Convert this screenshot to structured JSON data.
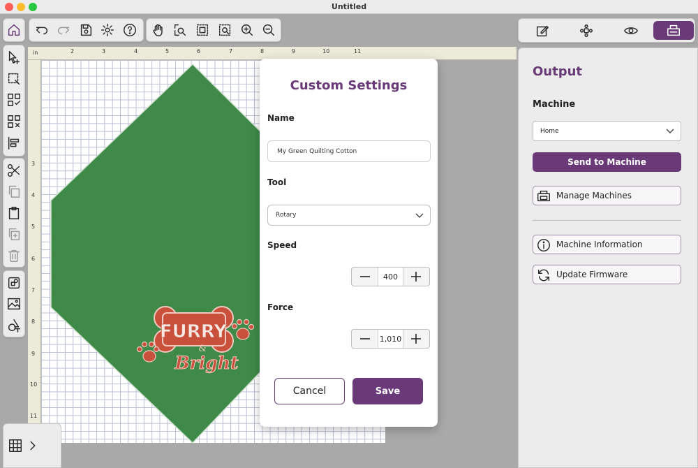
{
  "window": {
    "title": "Untitled"
  },
  "top_toolbar": {
    "icons": [
      "undo-icon",
      "redo-icon",
      "save-icon",
      "settings-icon",
      "help-icon"
    ],
    "view_icons": [
      "hand-icon",
      "zoom-selection-icon",
      "zoom-fit-icon",
      "zoom-page-icon",
      "zoom-in-icon",
      "zoom-out-icon"
    ]
  },
  "mode_bar": {
    "icons": [
      "edit-icon",
      "arrange-icon",
      "preview-icon",
      "output-icon"
    ],
    "active": "output-icon"
  },
  "left_toolbar": {
    "icons": [
      "home-icon",
      "select-add-icon",
      "marquee-select-icon",
      "group-icon",
      "ungroup-icon",
      "align-icon",
      "cut-icon",
      "copy-icon",
      "paste-icon",
      "duplicate-icon",
      "delete-icon",
      "arrange-image-icon",
      "trace-image-icon",
      "shapes-text-icon"
    ]
  },
  "ruler": {
    "unit": "in",
    "top_labels": [
      "2",
      "3",
      "4",
      "5",
      "6",
      "7",
      "8",
      "9",
      "10",
      "11"
    ],
    "left_labels": [
      "3",
      "4",
      "5",
      "6",
      "7",
      "8",
      "9",
      "10",
      "11"
    ]
  },
  "design": {
    "fill_color": "#3f8a48",
    "logo_line1": "FURRY",
    "logo_amp": "&",
    "logo_line2": "Bright",
    "logo_color": "#c9503b"
  },
  "modal": {
    "title": "Custom Settings",
    "name_label": "Name",
    "name_value": "My Green Quilting Cotton",
    "tool_label": "Tool",
    "tool_value": "Rotary",
    "speed_label": "Speed",
    "speed_value": "400",
    "force_label": "Force",
    "force_value": "1,010",
    "cancel_label": "Cancel",
    "save_label": "Save"
  },
  "output_panel": {
    "title": "Output",
    "machine_label": "Machine",
    "machine_value": "Home",
    "send_label": "Send to Machine",
    "manage_label": "Manage Machines",
    "info_label": "Machine Information",
    "firmware_label": "Update Firmware"
  },
  "colors": {
    "accent": "#6a3a78",
    "workspace": "#a9a9a9",
    "panel": "#ececec"
  }
}
